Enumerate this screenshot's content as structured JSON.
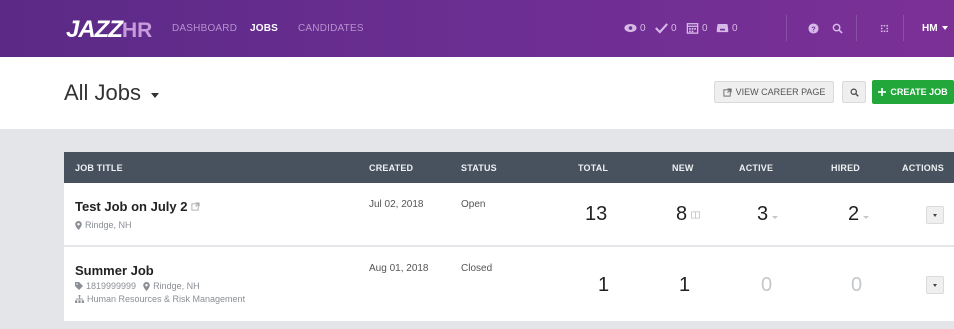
{
  "navbar": {
    "logo_main": "JAZZ",
    "logo_suffix": "HR",
    "links": [
      "DASHBOARD",
      "JOBS",
      "CANDIDATES"
    ],
    "active_link": "JOBS",
    "counters": {
      "views": "0",
      "approvals": "0",
      "calendar": "0",
      "messages": "0"
    },
    "user_initials": "HM"
  },
  "header": {
    "title": "All Jobs",
    "view_career_page": "VIEW CAREER PAGE",
    "create_job": "CREATE JOB"
  },
  "table": {
    "columns": [
      "JOB TITLE",
      "CREATED",
      "STATUS",
      "TOTAL",
      "NEW",
      "ACTIVE",
      "HIRED",
      "ACTIONS"
    ],
    "rows": [
      {
        "title": "Test Job on July 2",
        "location": "Rindge, NH",
        "created": "Jul 02, 2018",
        "status": "Open",
        "total": "13",
        "new": "8",
        "active": "3",
        "hired": "2"
      },
      {
        "title": "Summer Job",
        "code": "1819999999",
        "location": "Rindge, NH",
        "department": "Human Resources & Risk Management",
        "created": "Aug 01, 2018",
        "status": "Closed",
        "total": "1",
        "new": "1",
        "active": "0",
        "hired": "0"
      }
    ]
  },
  "colors": {
    "navbar_start": "#5b2a86",
    "navbar_end": "#7b3096",
    "create_button": "#22a73a",
    "table_header": "#47525e",
    "content_bg": "#e3e5e8"
  }
}
